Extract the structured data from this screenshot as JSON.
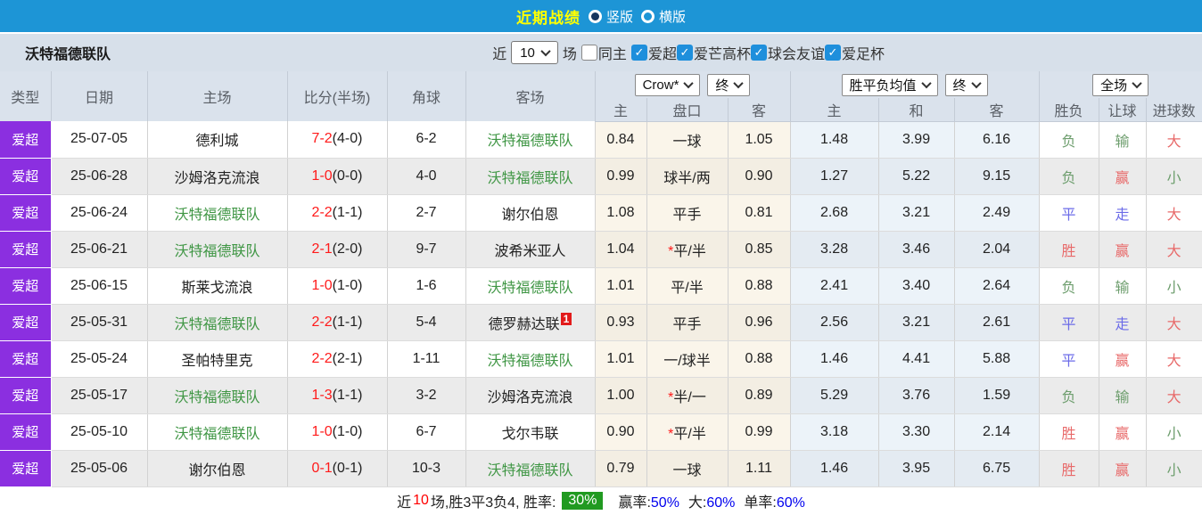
{
  "colors": {
    "accent_blue": "#1d95d6",
    "title_yellow": "#ffff00",
    "league_purple": "#8b2fe0",
    "team_green": "#3f9644",
    "score_red": "#ff1a1a",
    "result_red": "#e86a6a",
    "result_green": "#6e9e6e",
    "result_blue": "#6b6be8",
    "rate_badge_green": "#219a21",
    "value_blue": "#0000ee",
    "badge_red": "#e21b1b"
  },
  "topbar": {
    "title": "近期战绩",
    "options": [
      {
        "label": "竖版",
        "selected": true
      },
      {
        "label": "横版",
        "selected": false
      }
    ]
  },
  "filterbar": {
    "team": "沃特福德联队",
    "near_label": "近",
    "count_select": "10",
    "count_label": "场",
    "same_home": {
      "label": "同主",
      "checked": false
    },
    "leagues": [
      {
        "label": "爱超",
        "checked": true
      },
      {
        "label": "爱芒高杯",
        "checked": true
      },
      {
        "label": "球会友谊",
        "checked": true
      },
      {
        "label": "爱足杯",
        "checked": true
      }
    ]
  },
  "table": {
    "left_headers": [
      "类型",
      "日期",
      "主场",
      "比分(半场)",
      "角球",
      "客场"
    ],
    "group_headers": {
      "odds_select": "Crow*",
      "odds_state": "终",
      "avg_select": "胜平负均值",
      "avg_state": "终",
      "scope_select": "全场"
    },
    "sub_headers": [
      "主",
      "盘口",
      "客",
      "主",
      "和",
      "客",
      "胜负",
      "让球",
      "进球数"
    ],
    "rows": [
      {
        "league": "爱超",
        "date": "25-07-05",
        "home": "德利城",
        "home_focus": false,
        "score": "7-2",
        "half": "(4-0)",
        "corner": "6-2",
        "away": "沃特福德联队",
        "away_focus": true,
        "away_badge": "",
        "odds": [
          "0.84",
          "一球",
          "1.05"
        ],
        "handicap_star": false,
        "avg": [
          "1.48",
          "3.99",
          "6.16"
        ],
        "wdl": {
          "t": "负",
          "c": "green"
        },
        "let_res": {
          "t": "输",
          "c": "green"
        },
        "goal_res": {
          "t": "大",
          "c": "red"
        }
      },
      {
        "league": "爱超",
        "date": "25-06-28",
        "home": "沙姆洛克流浪",
        "home_focus": false,
        "score": "1-0",
        "half": "(0-0)",
        "corner": "4-0",
        "away": "沃特福德联队",
        "away_focus": true,
        "away_badge": "",
        "odds": [
          "0.99",
          "球半/两",
          "0.90"
        ],
        "handicap_star": false,
        "avg": [
          "1.27",
          "5.22",
          "9.15"
        ],
        "wdl": {
          "t": "负",
          "c": "green"
        },
        "let_res": {
          "t": "赢",
          "c": "red"
        },
        "goal_res": {
          "t": "小",
          "c": "green"
        }
      },
      {
        "league": "爱超",
        "date": "25-06-24",
        "home": "沃特福德联队",
        "home_focus": true,
        "score": "2-2",
        "half": "(1-1)",
        "corner": "2-7",
        "away": "谢尔伯恩",
        "away_focus": false,
        "away_badge": "",
        "odds": [
          "1.08",
          "平手",
          "0.81"
        ],
        "handicap_star": false,
        "avg": [
          "2.68",
          "3.21",
          "2.49"
        ],
        "wdl": {
          "t": "平",
          "c": "blue"
        },
        "let_res": {
          "t": "走",
          "c": "blue"
        },
        "goal_res": {
          "t": "大",
          "c": "red"
        }
      },
      {
        "league": "爱超",
        "date": "25-06-21",
        "home": "沃特福德联队",
        "home_focus": true,
        "score": "2-1",
        "half": "(2-0)",
        "corner": "9-7",
        "away": "波希米亚人",
        "away_focus": false,
        "away_badge": "",
        "odds": [
          "1.04",
          "平/半",
          "0.85"
        ],
        "handicap_star": true,
        "avg": [
          "3.28",
          "3.46",
          "2.04"
        ],
        "wdl": {
          "t": "胜",
          "c": "red"
        },
        "let_res": {
          "t": "赢",
          "c": "red"
        },
        "goal_res": {
          "t": "大",
          "c": "red"
        }
      },
      {
        "league": "爱超",
        "date": "25-06-15",
        "home": "斯莱戈流浪",
        "home_focus": false,
        "score": "1-0",
        "half": "(1-0)",
        "corner": "1-6",
        "away": "沃特福德联队",
        "away_focus": true,
        "away_badge": "",
        "odds": [
          "1.01",
          "平/半",
          "0.88"
        ],
        "handicap_star": false,
        "avg": [
          "2.41",
          "3.40",
          "2.64"
        ],
        "wdl": {
          "t": "负",
          "c": "green"
        },
        "let_res": {
          "t": "输",
          "c": "green"
        },
        "goal_res": {
          "t": "小",
          "c": "green"
        }
      },
      {
        "league": "爱超",
        "date": "25-05-31",
        "home": "沃特福德联队",
        "home_focus": true,
        "score": "2-2",
        "half": "(1-1)",
        "corner": "5-4",
        "away": "德罗赫达联",
        "away_focus": false,
        "away_badge": "1",
        "odds": [
          "0.93",
          "平手",
          "0.96"
        ],
        "handicap_star": false,
        "avg": [
          "2.56",
          "3.21",
          "2.61"
        ],
        "wdl": {
          "t": "平",
          "c": "blue"
        },
        "let_res": {
          "t": "走",
          "c": "blue"
        },
        "goal_res": {
          "t": "大",
          "c": "red"
        }
      },
      {
        "league": "爱超",
        "date": "25-05-24",
        "home": "圣帕特里克",
        "home_focus": false,
        "score": "2-2",
        "half": "(2-1)",
        "corner": "1-11",
        "away": "沃特福德联队",
        "away_focus": true,
        "away_badge": "",
        "odds": [
          "1.01",
          "一/球半",
          "0.88"
        ],
        "handicap_star": false,
        "avg": [
          "1.46",
          "4.41",
          "5.88"
        ],
        "wdl": {
          "t": "平",
          "c": "blue"
        },
        "let_res": {
          "t": "赢",
          "c": "red"
        },
        "goal_res": {
          "t": "大",
          "c": "red"
        }
      },
      {
        "league": "爱超",
        "date": "25-05-17",
        "home": "沃特福德联队",
        "home_focus": true,
        "score": "1-3",
        "half": "(1-1)",
        "corner": "3-2",
        "away": "沙姆洛克流浪",
        "away_focus": false,
        "away_badge": "",
        "odds": [
          "1.00",
          "半/一",
          "0.89"
        ],
        "handicap_star": true,
        "avg": [
          "5.29",
          "3.76",
          "1.59"
        ],
        "wdl": {
          "t": "负",
          "c": "green"
        },
        "let_res": {
          "t": "输",
          "c": "green"
        },
        "goal_res": {
          "t": "大",
          "c": "red"
        }
      },
      {
        "league": "爱超",
        "date": "25-05-10",
        "home": "沃特福德联队",
        "home_focus": true,
        "score": "1-0",
        "half": "(1-0)",
        "corner": "6-7",
        "away": "戈尔韦联",
        "away_focus": false,
        "away_badge": "",
        "odds": [
          "0.90",
          "平/半",
          "0.99"
        ],
        "handicap_star": true,
        "avg": [
          "3.18",
          "3.30",
          "2.14"
        ],
        "wdl": {
          "t": "胜",
          "c": "red"
        },
        "let_res": {
          "t": "赢",
          "c": "red"
        },
        "goal_res": {
          "t": "小",
          "c": "green"
        }
      },
      {
        "league": "爱超",
        "date": "25-05-06",
        "home": "谢尔伯恩",
        "home_focus": false,
        "score": "0-1",
        "half": "(0-1)",
        "corner": "10-3",
        "away": "沃特福德联队",
        "away_focus": true,
        "away_badge": "",
        "odds": [
          "0.79",
          "一球",
          "1.11"
        ],
        "handicap_star": false,
        "avg": [
          "1.46",
          "3.95",
          "6.75"
        ],
        "wdl": {
          "t": "胜",
          "c": "red"
        },
        "let_res": {
          "t": "赢",
          "c": "red"
        },
        "goal_res": {
          "t": "小",
          "c": "green"
        }
      }
    ]
  },
  "footer": {
    "near_label": "近",
    "count": "10",
    "middle": "场,胜3平3负4, 胜率:",
    "win_rate": "30%",
    "segments": [
      {
        "label": "赢率:",
        "value": "50%"
      },
      {
        "label": "大:",
        "value": "60%"
      },
      {
        "label": "单率:",
        "value": "60%"
      }
    ]
  }
}
